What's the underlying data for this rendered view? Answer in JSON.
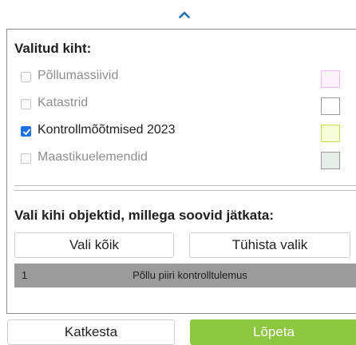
{
  "layers": {
    "title": "Valitud kiht:",
    "items": [
      {
        "label": "Põllumassiivid",
        "checked": false,
        "swatch": "#f4b8f4",
        "swatch_fill": "#fdf3fd"
      },
      {
        "label": "Katastrid",
        "checked": false,
        "swatch": "#9a9a9a",
        "swatch_fill": "#ffffff"
      },
      {
        "label": "Kontrollmõõtmised 2023",
        "checked": true,
        "swatch": "#c9e24a",
        "swatch_fill": "#f6fbd9"
      },
      {
        "label": "Maastikuelemendid",
        "checked": false,
        "swatch": "#9a9a9a",
        "swatch_fill": "#e6ede9"
      }
    ]
  },
  "objects": {
    "title": "Vali kihi objektid, millega soovid jätkata:",
    "select_all_label": "Vali kõik",
    "clear_label": "Tühista valik",
    "results": [
      {
        "number": "1",
        "name": "Põllu piiri kontrolltulemus"
      }
    ]
  },
  "footer": {
    "cancel_label": "Katkesta",
    "finish_label": "Lõpeta"
  },
  "colors": {
    "accent_green": "#8dc63f",
    "checkbox_blue": "#1a73e8",
    "chevron_blue": "#1e6db5"
  }
}
